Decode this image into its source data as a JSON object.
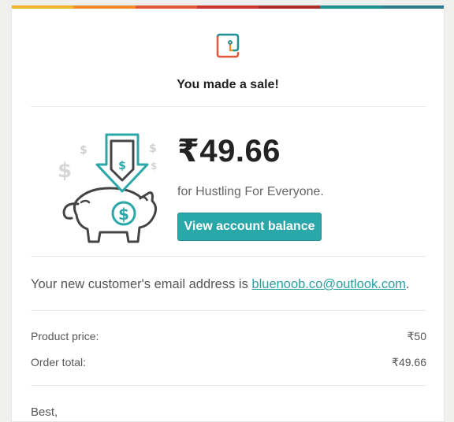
{
  "brand": {
    "stripe_colors": [
      "#f0b429",
      "#ef8a2d",
      "#e4583a",
      "#c9352d",
      "#b12a2a",
      "#1f8f91",
      "#2a7b8c"
    ],
    "accent": "#2aa7a8",
    "logo_icon": "gumroad-logo-icon"
  },
  "headline": "You made a sale!",
  "sale": {
    "amount": "₹49.66",
    "for_text": "for Hustling For Everyone.",
    "cta_label": "View account balance",
    "illustration": "piggy-bank-deposit-icon"
  },
  "customer": {
    "email_prefix": "Your new customer's email address is ",
    "email": "bluenoob.co@outlook.com",
    "email_suffix": "."
  },
  "summary": [
    {
      "label": "Product price:",
      "value": "₹50"
    },
    {
      "label": "Order total:",
      "value": "₹49.66"
    }
  ],
  "closing": "Best,"
}
